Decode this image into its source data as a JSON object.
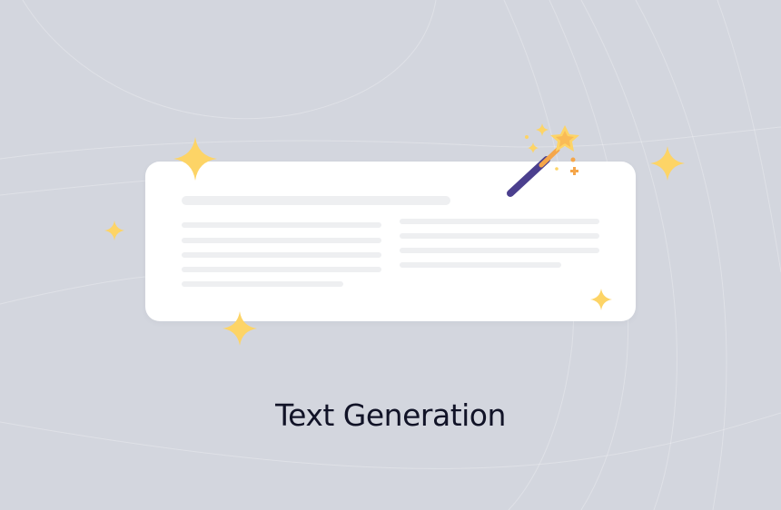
{
  "caption": {
    "text": "Text Generation"
  },
  "illustration": {
    "card_icon": "document-card-icon",
    "wand_icon": "magic-wand-icon",
    "sparkle_icon": "sparkle-icon"
  },
  "colors": {
    "background": "#d3d6de",
    "card": "#ffffff",
    "placeholder_line": "#eeeff1",
    "sparkle": "#fdd466",
    "wand_handle": "#4b3f8e",
    "wand_tip": "#f5a64a",
    "caption_text": "#111327"
  }
}
